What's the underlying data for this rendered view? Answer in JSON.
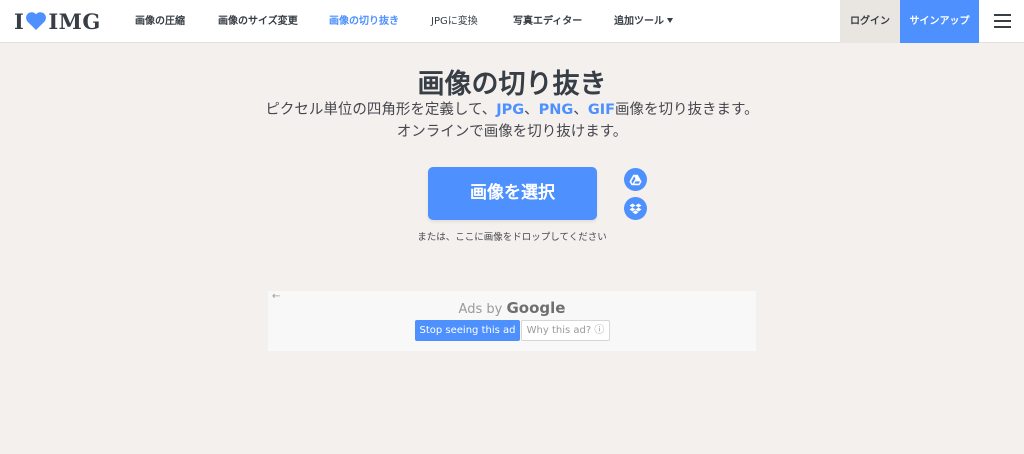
{
  "logo": {
    "left": "I",
    "right": "IMG"
  },
  "nav": {
    "items": [
      {
        "label": "画像の圧縮"
      },
      {
        "label": "画像のサイズ変更"
      },
      {
        "label": "画像の切り抜き"
      },
      {
        "label": "JPGに変換"
      },
      {
        "label": "写真エディター"
      },
      {
        "label": "追加ツール"
      }
    ],
    "login": "ログイン",
    "signup": "サインアップ"
  },
  "main": {
    "title": "画像の切り抜き",
    "subtitle_line1_a": "ピクセル単位の四角形を定義して、",
    "fmt_jpg": "JPG",
    "sep1": "、",
    "fmt_png": "PNG",
    "sep2": "、",
    "fmt_gif": "GIF",
    "subtitle_line1_b": "画像を切り抜きます。",
    "subtitle_line2": "オンラインで画像を切り抜けます。",
    "select_button": "画像を選択",
    "drop_text": "または、ここに画像をドロップしてください"
  },
  "ad": {
    "back_arrow": "←",
    "ads_by": "Ads by",
    "google": "Google",
    "stop": "Stop seeing this ad",
    "why": "Why this ad? ⓘ"
  },
  "colors": {
    "accent": "#4d90fe",
    "text": "#383e45",
    "background": "#f3f0ed"
  },
  "icons": [
    "heart-icon",
    "caret-down-icon",
    "menu-icon",
    "google-drive-icon",
    "dropbox-icon"
  ]
}
